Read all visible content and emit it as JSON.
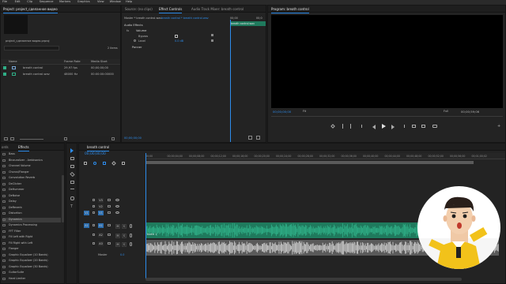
{
  "menu": [
    "File",
    "Edit",
    "Clip",
    "Sequence",
    "Markers",
    "Graphics",
    "View",
    "Window",
    "Help"
  ],
  "project": {
    "tab": "Project: project_сделанное видео",
    "file_name": "project_сделанное видео.prproj",
    "items_count": "2 items",
    "columns": [
      "Name",
      "Frame Rate",
      "Media Start"
    ],
    "rows": [
      {
        "name": "breath control",
        "rate": "29,97 fps",
        "start": "00;00;00;00"
      },
      {
        "name": "breath control.wav",
        "rate": "48000 Hz",
        "start": "00:00:00:00000"
      }
    ]
  },
  "effect_controls": {
    "tabs": [
      "Source: (no clips)",
      "Effect Controls",
      "Audio Track Mixer: breath control"
    ],
    "clip_path": "Master * breath control.wav",
    "seq_path": "breath control * breath control.wav",
    "time_start": "00;00",
    "time_end": "00;0",
    "clip_label": "breath control.wav",
    "section": "Audio Effects",
    "fx_volume": "fx",
    "volume": "Volume",
    "bypass": "Bypass",
    "level_label": "Level",
    "level_value": "0.0 dB",
    "panner": "Panner",
    "timecode": "00;00;00;00"
  },
  "program": {
    "title": "Program: breath control",
    "timecode_left": "00;00;00;00",
    "fit": "Fit",
    "full": "Full",
    "timecode_right": "00;00;59;06"
  },
  "effects_panel": {
    "tabs": [
      "ords",
      "Effects"
    ],
    "items": [
      "Bass",
      "Binauralizer - Ambisonics",
      "Channel Volume",
      "Chorus/Flanger",
      "Convolution Reverb",
      "DeClicker",
      "DeHummer",
      "DeNoise",
      "Delay",
      "DeReverb",
      "Distortion",
      "Dynamics",
      "Dynamics Processing",
      "FFT Filter",
      "Fill Left with Right",
      "Fill Right with Left",
      "Flanger",
      "Graphic Equalizer (10 Bands)",
      "Graphic Equalizer (20 Bands)",
      "Graphic Equalizer (30 Bands)",
      "GuitarSuite",
      "Hard Limiter"
    ],
    "selected_index": 11
  },
  "timeline": {
    "tab": "breath control",
    "timecode": "00;00;00;00",
    "ticks": [
      "00;00",
      "00;00;04;00",
      "00;00;08;00",
      "00;00;12;00",
      "00;00;16;00",
      "00;00;20;00",
      "00;00;24;00",
      "00;00;28;00",
      "00;00;32;00",
      "00;00;36;00",
      "00;00;40;00",
      "00;00;44;00",
      "00;00;48;00",
      "00;00;52;00",
      "00;00;56;00",
      "00;01;00;02"
    ],
    "video_tracks": [
      "V3",
      "V2",
      "V1"
    ],
    "audio_tracks": [
      "A1",
      "A2",
      "A3"
    ],
    "master_label": "Master",
    "master_value": "0.0",
    "audio_label": "Audio 1",
    "source_v": "V1",
    "source_a": "A1",
    "m": "M",
    "s": "S",
    "colors": {
      "audio_clip": "#2fae86",
      "audio_clip_dark": "#1f7a5d",
      "selected_clip": "#c9c9c9",
      "accent": "#2d8ceb"
    }
  }
}
